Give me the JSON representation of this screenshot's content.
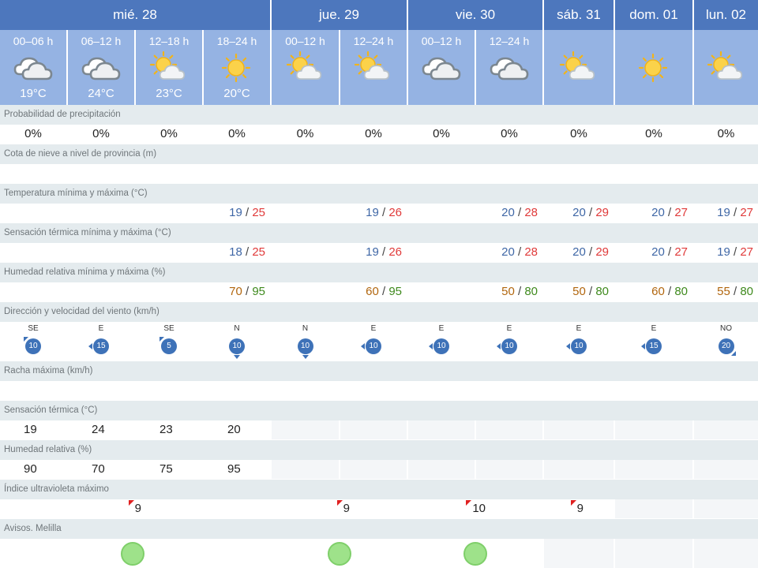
{
  "days": [
    {
      "label": "mié. 28"
    },
    {
      "label": "jue. 29"
    },
    {
      "label": "vie. 30"
    },
    {
      "label": "sáb. 31"
    },
    {
      "label": "dom. 01"
    },
    {
      "label": "lun. 02"
    }
  ],
  "periods": [
    {
      "label": "00–06 h",
      "icon": "cloudy-icon",
      "temp": "19°C"
    },
    {
      "label": "06–12 h",
      "icon": "cloudy-icon",
      "temp": "24°C"
    },
    {
      "label": "12–18 h",
      "icon": "sun-cloud-icon",
      "temp": "23°C"
    },
    {
      "label": "18–24 h",
      "icon": "sun-icon",
      "temp": "20°C"
    },
    {
      "label": "00–12 h",
      "icon": "sun-cloud-icon",
      "temp": ""
    },
    {
      "label": "12–24 h",
      "icon": "sun-cloud-icon",
      "temp": ""
    },
    {
      "label": "00–12 h",
      "icon": "cloudy-icon",
      "temp": ""
    },
    {
      "label": "12–24 h",
      "icon": "cloudy-icon",
      "temp": ""
    },
    {
      "label": "",
      "icon": "sun-cloud-icon",
      "temp": ""
    },
    {
      "label": "",
      "icon": "sun-icon",
      "temp": ""
    },
    {
      "label": "",
      "icon": "sun-cloud-icon",
      "temp": ""
    }
  ],
  "rows": {
    "precip": {
      "label": "Probabilidad de precipitación",
      "values": [
        "0%",
        "0%",
        "0%",
        "0%",
        "0%",
        "0%",
        "0%",
        "0%",
        "0%",
        "0%",
        "0%"
      ]
    },
    "snow": {
      "label": "Cota de nieve a nivel de provincia (m)"
    },
    "temp": {
      "label": "Temperatura mínima y máxima (°C)",
      "values": [
        {
          "min": "19",
          "max": "25"
        },
        {
          "min": "19",
          "max": "26"
        },
        {
          "min": "20",
          "max": "28"
        },
        {
          "min": "20",
          "max": "29"
        },
        {
          "min": "20",
          "max": "27"
        },
        {
          "min": "19",
          "max": "27"
        }
      ]
    },
    "feels": {
      "label": "Sensación térmica mínima y máxima (°C)",
      "values": [
        {
          "min": "18",
          "max": "25"
        },
        {
          "min": "19",
          "max": "26"
        },
        {
          "min": "20",
          "max": "28"
        },
        {
          "min": "20",
          "max": "29"
        },
        {
          "min": "20",
          "max": "27"
        },
        {
          "min": "19",
          "max": "27"
        }
      ]
    },
    "humidity": {
      "label": "Humedad relativa mínima y máxima (%)",
      "values": [
        {
          "min": "70",
          "max": "95"
        },
        {
          "min": "60",
          "max": "95"
        },
        {
          "min": "50",
          "max": "80"
        },
        {
          "min": "50",
          "max": "80"
        },
        {
          "min": "60",
          "max": "80"
        },
        {
          "min": "55",
          "max": "80"
        }
      ]
    },
    "wind": {
      "label": "Dirección y velocidad del viento (km/h)",
      "values": [
        {
          "dir": "SE",
          "speed": "10"
        },
        {
          "dir": "E",
          "speed": "15"
        },
        {
          "dir": "SE",
          "speed": "5"
        },
        {
          "dir": "N",
          "speed": "10"
        },
        {
          "dir": "N",
          "speed": "10"
        },
        {
          "dir": "E",
          "speed": "10"
        },
        {
          "dir": "E",
          "speed": "10"
        },
        {
          "dir": "E",
          "speed": "10"
        },
        {
          "dir": "E",
          "speed": "10"
        },
        {
          "dir": "E",
          "speed": "15"
        },
        {
          "dir": "NO",
          "speed": "20"
        }
      ]
    },
    "gust": {
      "label": "Racha máxima (km/h)"
    },
    "feels_period": {
      "label": "Sensación térmica (°C)",
      "values": [
        "19",
        "24",
        "23",
        "20"
      ]
    },
    "humidity_period": {
      "label": "Humedad relativa (%)",
      "values": [
        "90",
        "70",
        "75",
        "95"
      ]
    },
    "uv": {
      "label": "Índice ultravioleta máximo",
      "values": [
        "9",
        "9",
        "10",
        "9"
      ]
    },
    "alerts": {
      "label": "Avisos. Melilla"
    }
  }
}
